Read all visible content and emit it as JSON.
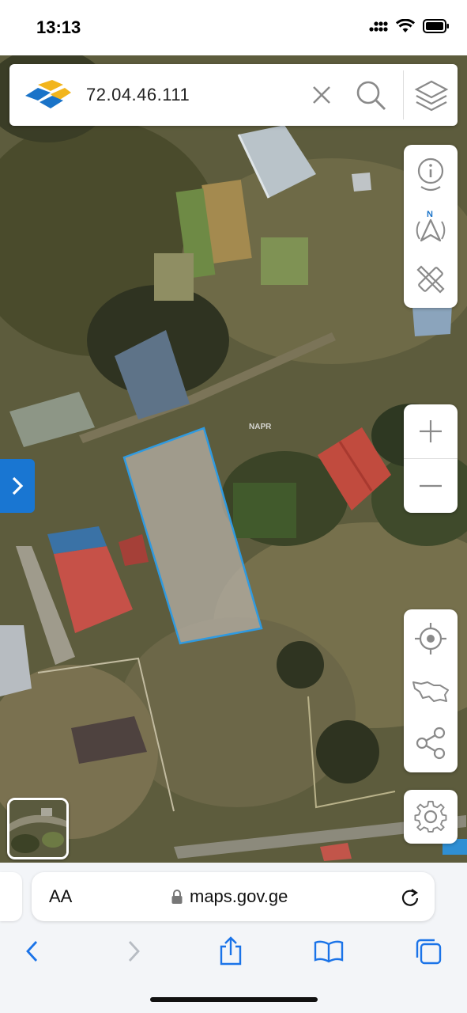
{
  "status_bar": {
    "time": "13:13"
  },
  "search": {
    "query": "72.04.46.111"
  },
  "map": {
    "watermark": "NAPR"
  },
  "browser": {
    "text_size_label": "AA",
    "host": "maps.gov.ge"
  },
  "colors": {
    "parcel_outline": "#2f9ae0",
    "accent": "#1976d2"
  },
  "icons": {
    "search_bar": [
      "logo-icon",
      "clear-icon",
      "search-icon",
      "layers-icon"
    ],
    "tools": [
      "info-pin-icon",
      "north-arrow-icon",
      "measure-icon"
    ],
    "zoom": [
      "zoom-in-icon",
      "zoom-out-icon"
    ],
    "actions": [
      "locate-icon",
      "georgia-map-icon",
      "share-icon"
    ],
    "settings": "gear-icon"
  }
}
